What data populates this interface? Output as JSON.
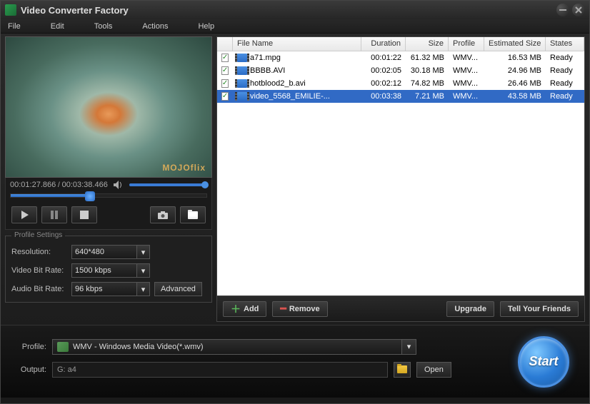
{
  "window": {
    "title": "Video Converter Factory"
  },
  "menu": [
    "File",
    "Edit",
    "Tools",
    "Actions",
    "Help"
  ],
  "preview": {
    "watermark": "MOJOflix"
  },
  "playback": {
    "current": "00:01:27.866",
    "total": "00:03:38.466",
    "progress_pct": 40,
    "volume_pct": 95
  },
  "profile_settings": {
    "legend": "Profile Settings",
    "labels": {
      "resolution": "Resolution:",
      "vbitrate": "Video Bit Rate:",
      "abitrate": "Audio Bit Rate:"
    },
    "resolution": "640*480",
    "video_bitrate": "1500 kbps",
    "audio_bitrate": "96 kbps",
    "advanced": "Advanced"
  },
  "file_table": {
    "headers": {
      "name": "File Name",
      "duration": "Duration",
      "size": "Size",
      "profile": "Profile",
      "est": "Estimated Size",
      "state": "States"
    },
    "rows": [
      {
        "checked": true,
        "name": "a71.mpg",
        "duration": "00:01:22",
        "size": "61.32 MB",
        "profile": "WMV...",
        "est": "16.53 MB",
        "state": "Ready",
        "selected": false
      },
      {
        "checked": true,
        "name": "BBBB.AVI",
        "duration": "00:02:05",
        "size": "30.18 MB",
        "profile": "WMV...",
        "est": "24.96 MB",
        "state": "Ready",
        "selected": false
      },
      {
        "checked": true,
        "name": "hotblood2_b.avi",
        "duration": "00:02:12",
        "size": "74.82 MB",
        "profile": "WMV...",
        "est": "26.46 MB",
        "state": "Ready",
        "selected": false
      },
      {
        "checked": true,
        "name": "video_5568_EMILIE-...",
        "duration": "00:03:38",
        "size": "7.21 MB",
        "profile": "WMV...",
        "est": "43.58 MB",
        "state": "Ready",
        "selected": true
      }
    ]
  },
  "actions": {
    "add": "Add",
    "remove": "Remove",
    "upgrade": "Upgrade",
    "tell": "Tell Your Friends"
  },
  "bottom": {
    "profile_label": "Profile:",
    "profile_value": "WMV - Windows Media Video(*.wmv)",
    "output_label": "Output:",
    "output_value": "G: a4",
    "open": "Open",
    "start": "Start"
  }
}
